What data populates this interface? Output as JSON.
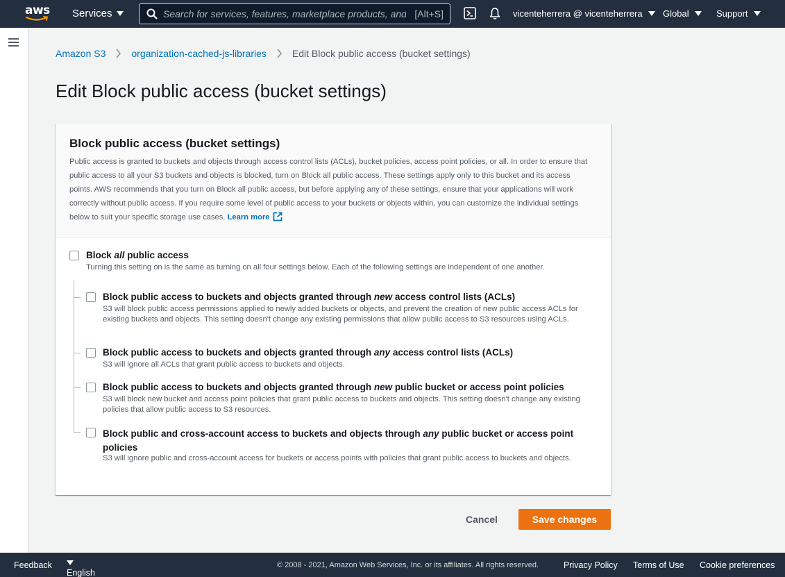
{
  "topnav": {
    "logo_text": "aws",
    "services_label": "Services",
    "search_placeholder": "Search for services, features, marketplace products, and docs",
    "search_hotkey": "[Alt+S]",
    "account_label": "vicenteherrera @ vicenteherrera",
    "region_label": "Global",
    "support_label": "Support",
    "icons": [
      "cloudshell-icon",
      "bell-icon",
      "search-icon"
    ]
  },
  "breadcrumb": {
    "items": [
      "Amazon S3",
      "organization-cached-js-libraries"
    ],
    "current": "Edit Block public access (bucket settings)"
  },
  "page": {
    "title": "Edit Block public access (bucket settings)"
  },
  "panel": {
    "heading": "Block public access (bucket settings)",
    "description": "Public access is granted to buckets and objects through access control lists (ACLs), bucket policies, access point policies, or all. In order to ensure that public access to all your S3 buckets and objects is blocked, turn on Block all public access. These settings apply only to this bucket and its access points. AWS recommends that you turn on Block all public access, but before applying any of these settings, ensure that your applications will work correctly without public access. If you require some level of public access to your buckets or objects within, you can customize the individual settings below to suit your specific storage use cases.",
    "learn_more": "Learn more",
    "block_all": {
      "title_pre": "Block ",
      "title_em": "all",
      "title_post": " public access",
      "description": "Turning this setting on is the same as turning on all four settings below. Each of the following settings are independent of one another.",
      "checked": false
    },
    "options": [
      {
        "title_pre": "Block public access to buckets and objects granted through ",
        "title_em": "new",
        "title_post": " access control lists (ACLs)",
        "description": "S3 will block public access permissions applied to newly added buckets or objects, and prevent the creation of new public access ACLs for existing buckets and objects. This setting doesn't change any existing permissions that allow public access to S3 resources using ACLs.",
        "checked": false
      },
      {
        "title_pre": "Block public access to buckets and objects granted through ",
        "title_em": "any",
        "title_post": " access control lists (ACLs)",
        "description": "S3 will ignore all ACLs that grant public access to buckets and objects.",
        "checked": false
      },
      {
        "title_pre": "Block public access to buckets and objects granted through ",
        "title_em": "new",
        "title_post": " public bucket or access point policies",
        "description": "S3 will block new bucket and access point policies that grant public access to buckets and objects. This setting doesn't change any existing policies that allow public access to S3 resources.",
        "checked": false
      },
      {
        "title_pre": "Block public and cross-account access to buckets and objects through ",
        "title_em": "any",
        "title_post": " public bucket or access point policies",
        "description": "S3 will ignore public and cross-account access for buckets or access points with policies that grant public access to buckets and objects.",
        "checked": false
      }
    ]
  },
  "actions": {
    "cancel_label": "Cancel",
    "save_label": "Save changes"
  },
  "footer": {
    "feedback": "Feedback",
    "language": "English (US)",
    "copyright": "© 2008 - 2021, Amazon Web Services, Inc. or its affiliates. All rights reserved.",
    "privacy": "Privacy Policy",
    "terms": "Terms of Use",
    "cookies": "Cookie preferences"
  },
  "colors": {
    "nav_bg": "#232f3e",
    "link": "#0073bb",
    "primary_button": "#ec7211",
    "aws_smile": "#ff9900"
  }
}
